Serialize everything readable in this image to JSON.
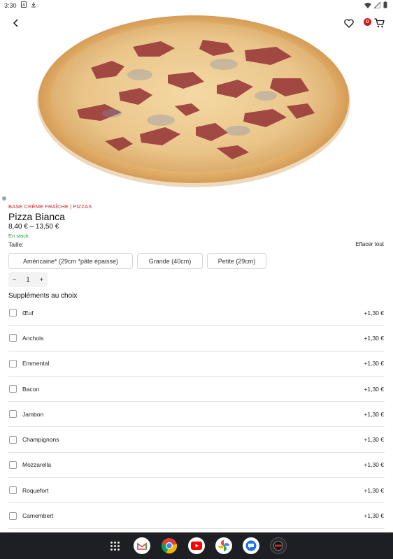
{
  "status_bar": {
    "time": "3:30"
  },
  "cart": {
    "count": "0"
  },
  "product": {
    "categories": "BASE CRÈME FRAÎCHE | PIZZAS",
    "title": "Pizza Bianca",
    "price": "8,40 € – 13,50 €",
    "stock": "En stock"
  },
  "size": {
    "label": "Taille:",
    "clear_label": "Effacer tout",
    "options": [
      "Américaine* (29cm *pâte épaisse)",
      "Grande (40cm)",
      "Petite (29cm)"
    ]
  },
  "quantity": {
    "minus": "−",
    "value": "1",
    "plus": "+"
  },
  "supplements": {
    "title": "Suppléments au choix",
    "items": [
      {
        "name": "Œuf",
        "price": "+1,30 €"
      },
      {
        "name": "Anchois",
        "price": "+1,30 €"
      },
      {
        "name": "Emmental",
        "price": "+1,30 €"
      },
      {
        "name": "Bacon",
        "price": "+1,30 €"
      },
      {
        "name": "Jambon",
        "price": "+1,30 €"
      },
      {
        "name": "Champignons",
        "price": "+1,30 €"
      },
      {
        "name": "Mozzarella",
        "price": "+1,30 €"
      },
      {
        "name": "Roquefort",
        "price": "+1,30 €"
      },
      {
        "name": "Camembert",
        "price": "+1,30 €"
      }
    ]
  },
  "colors": {
    "accent_red": "#c62828",
    "badge_red": "#d11a1a",
    "stock_green": "#2e9e3e",
    "nav_bg": "#1d1f24"
  },
  "dock": {
    "apps": [
      "apps-grid-icon",
      "gmail-icon",
      "chrome-icon",
      "youtube-icon",
      "photos-icon",
      "messages-icon",
      "pizza-app-icon"
    ]
  }
}
